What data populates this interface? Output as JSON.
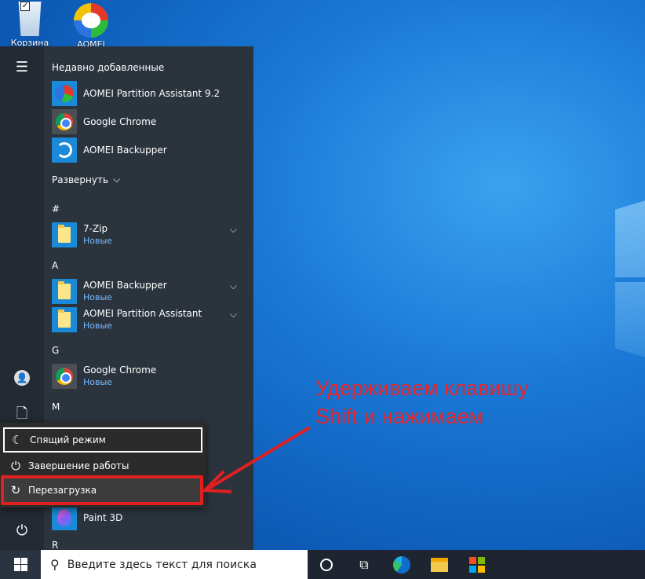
{
  "desktop": {
    "icons": [
      {
        "label": "Корзина"
      },
      {
        "label": "AOMEI"
      }
    ]
  },
  "start_menu": {
    "recent_header": "Недавно добавленные",
    "recent": [
      {
        "name": "AOMEI Partition Assistant 9.2"
      },
      {
        "name": "Google Chrome"
      },
      {
        "name": "AOMEI Backupper"
      }
    ],
    "expand_label": "Развернуть",
    "groups": [
      {
        "letter": "#",
        "apps": [
          {
            "name": "7-Zip",
            "sub": "Новые"
          }
        ]
      },
      {
        "letter": "A",
        "apps": [
          {
            "name": "AOMEI Backupper",
            "sub": "Новые"
          },
          {
            "name": "AOMEI Partition Assistant",
            "sub": "Новые"
          }
        ]
      },
      {
        "letter": "G",
        "apps": [
          {
            "name": "Google Chrome",
            "sub": "Новые"
          }
        ]
      },
      {
        "letter": "M",
        "apps": []
      },
      {
        "letter": "",
        "apps": [
          {
            "name": "Paint 3D"
          }
        ]
      },
      {
        "letter": "R",
        "apps": []
      }
    ]
  },
  "power_menu": {
    "sleep": "Спящий режим",
    "shutdown": "Завершение работы",
    "restart": "Перезагрузка"
  },
  "annotation": {
    "line1": "Удерживаем клавишу",
    "line2": "Shift и нажимаем",
    "color": "#e5262b"
  },
  "taskbar": {
    "search_placeholder": "Введите здесь текст для поиска"
  }
}
